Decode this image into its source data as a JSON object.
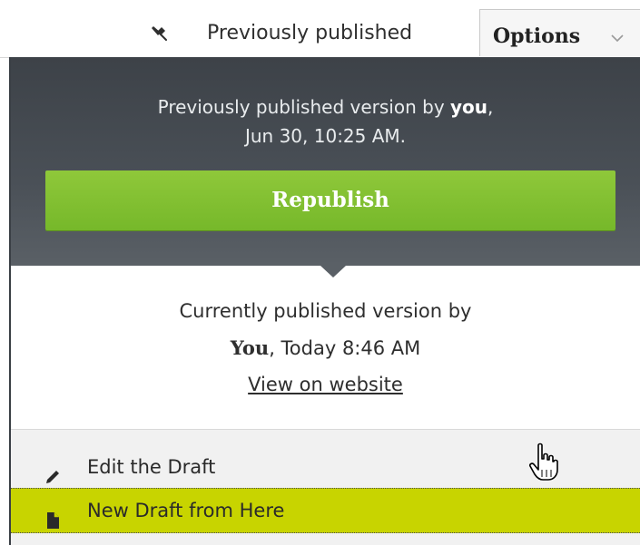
{
  "topbar": {
    "pin_icon": "pin-icon",
    "previously_published_label": "Previously published",
    "options_label": "Options",
    "options_chevron_icon": "chevron-down-icon"
  },
  "published_panel": {
    "previous_version_prefix": "Previously published version by ",
    "previous_version_user": "you",
    "previous_version_suffix": ",",
    "previous_version_date": "Jun 30, 10:25 AM.",
    "republish_label": "Republish",
    "current_version_prefix": "Currently published version by",
    "current_version_user": "You",
    "current_version_date": ", Today 8:46 AM",
    "view_on_website_label": "View on website"
  },
  "menu": {
    "items": [
      {
        "label": "Edit the Draft",
        "icon": "pencil-icon"
      },
      {
        "label": "New Draft from Here",
        "icon": "document-icon"
      }
    ]
  },
  "colors": {
    "panel_dark": "#4a5057",
    "republish_green": "#80bf30",
    "highlight": "#c8d400"
  }
}
